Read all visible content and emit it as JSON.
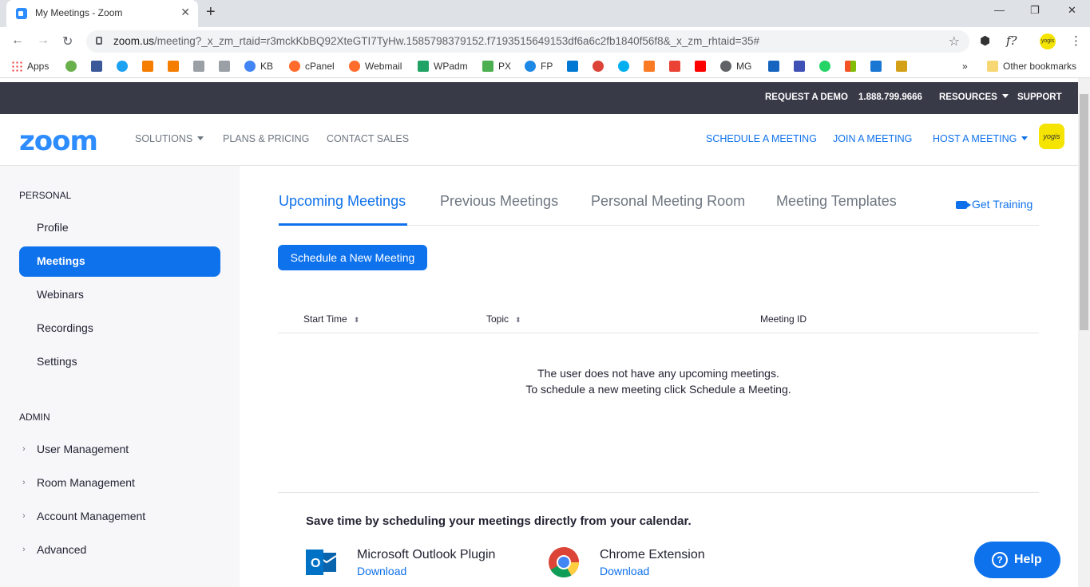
{
  "browser": {
    "tab_title": "My Meetings - Zoom",
    "url_main": "zoom.us",
    "url_rest": "/meeting?_x_zm_rtaid=r3mckKbBQ92XteGTI7TyHw.1585798379152.f7193515649153df6a6c2fb1840f56f8&_x_zm_rhtaid=35#",
    "ext_label": "f?",
    "profile_label": "yogis",
    "bookmarks": [
      "Apps",
      "KB",
      "cPanel",
      "Webmail",
      "WPadm",
      "PX",
      "FP",
      "MG"
    ],
    "more_bookmarks": "»",
    "other_bookmarks": "Other bookmarks"
  },
  "topbar": {
    "request_demo": "REQUEST A DEMO",
    "phone": "1.888.799.9666",
    "resources": "RESOURCES",
    "support": "SUPPORT"
  },
  "nav": {
    "logo": "zoom",
    "solutions": "SOLUTIONS",
    "plans": "PLANS & PRICING",
    "contact": "CONTACT SALES",
    "schedule": "SCHEDULE A MEETING",
    "join": "JOIN A MEETING",
    "host": "HOST A MEETING",
    "avatar": "yogis"
  },
  "sidebar": {
    "personal_label": "PERSONAL",
    "personal_items": [
      "Profile",
      "Meetings",
      "Webinars",
      "Recordings",
      "Settings"
    ],
    "admin_label": "ADMIN",
    "admin_items": [
      "User Management",
      "Room Management",
      "Account Management",
      "Advanced"
    ]
  },
  "main": {
    "tabs": [
      "Upcoming Meetings",
      "Previous Meetings",
      "Personal Meeting Room",
      "Meeting Templates"
    ],
    "get_training": "Get Training",
    "schedule_button": "Schedule a New Meeting",
    "columns": [
      "Start Time",
      "Topic",
      "Meeting ID"
    ],
    "empty_line1": "The user does not have any upcoming meetings.",
    "empty_line2": "To schedule a new meeting click Schedule a Meeting.",
    "calendar_heading": "Save time by scheduling your meetings directly from your calendar.",
    "plugins": [
      {
        "title": "Microsoft Outlook Plugin",
        "link": "Download"
      },
      {
        "title": "Chrome Extension",
        "link": "Download"
      }
    ],
    "help": "Help"
  },
  "colors": {
    "accent": "#0e72ed",
    "topbar": "#393a48",
    "sidebar": "#f7f7fa"
  }
}
